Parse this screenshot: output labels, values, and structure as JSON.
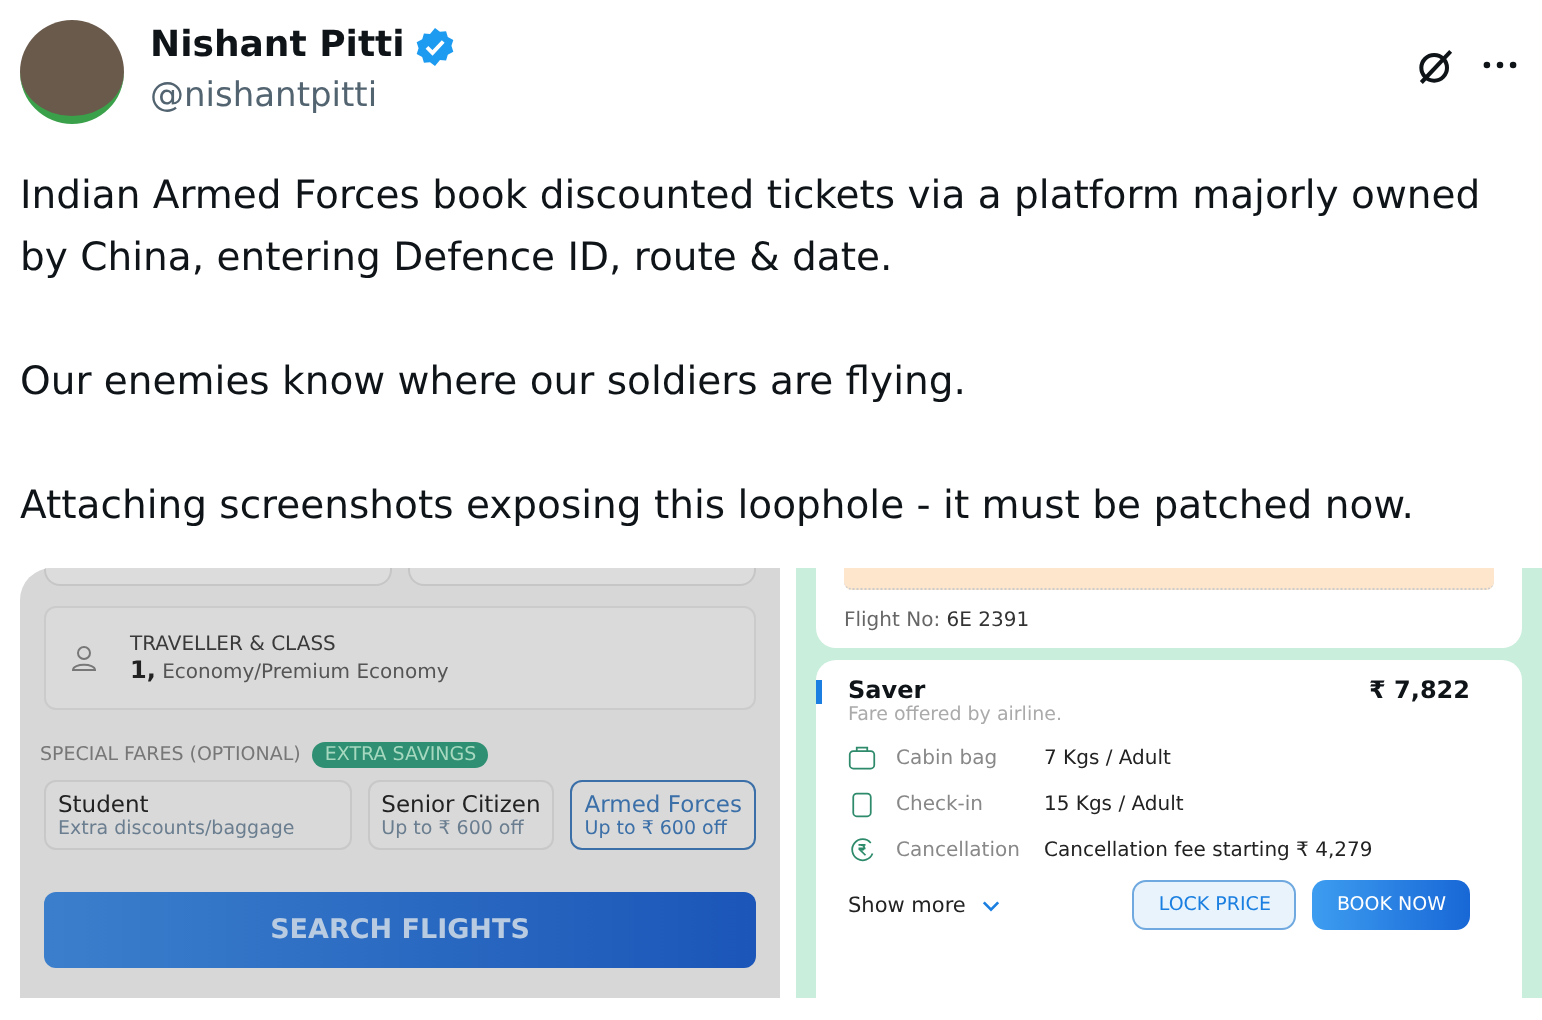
{
  "post": {
    "author": "Nishant Pitti",
    "verified": true,
    "handle": "@nishantpitti",
    "paragraphs": [
      "Indian Armed Forces book discounted tickets via a platform majorly owned by China, entering Defence ID, route & date.",
      "Our enemies know where our soldiers are flying.",
      "Attaching screenshots exposing this loophole - it must be patched now."
    ]
  },
  "search_screen": {
    "traveller_label": "TRAVELLER & CLASS",
    "traveller_count": "1,",
    "traveller_class": "Economy/Premium Economy",
    "special_fares_label": "SPECIAL FARES (OPTIONAL)",
    "special_fares_badge": "EXTRA SAVINGS",
    "fares": [
      {
        "title": "Student",
        "subtitle": "Extra discounts/baggage",
        "selected": false
      },
      {
        "title": "Senior Citizen",
        "subtitle": "Up to ₹ 600 off",
        "selected": false
      },
      {
        "title": "Armed Forces",
        "subtitle": "Up to ₹ 600 off",
        "selected": true
      }
    ],
    "search_button": "SEARCH FLIGHTS"
  },
  "fare_screen": {
    "flight_label": "Flight No:",
    "flight_number": "6E 2391",
    "fare_name": "Saver",
    "fare_price": "₹ 7,822",
    "fare_note": "Fare offered by airline.",
    "features": [
      {
        "kind": "cabin",
        "label": "Cabin bag",
        "value": "7 Kgs / Adult"
      },
      {
        "kind": "checkin",
        "label": "Check-in",
        "value": "15 Kgs / Adult"
      },
      {
        "kind": "cancel",
        "label": "Cancellation",
        "value": "Cancellation fee starting ₹ 4,279"
      }
    ],
    "show_more": "Show more",
    "lock_button": "LOCK PRICE",
    "book_button": "BOOK NOW"
  }
}
